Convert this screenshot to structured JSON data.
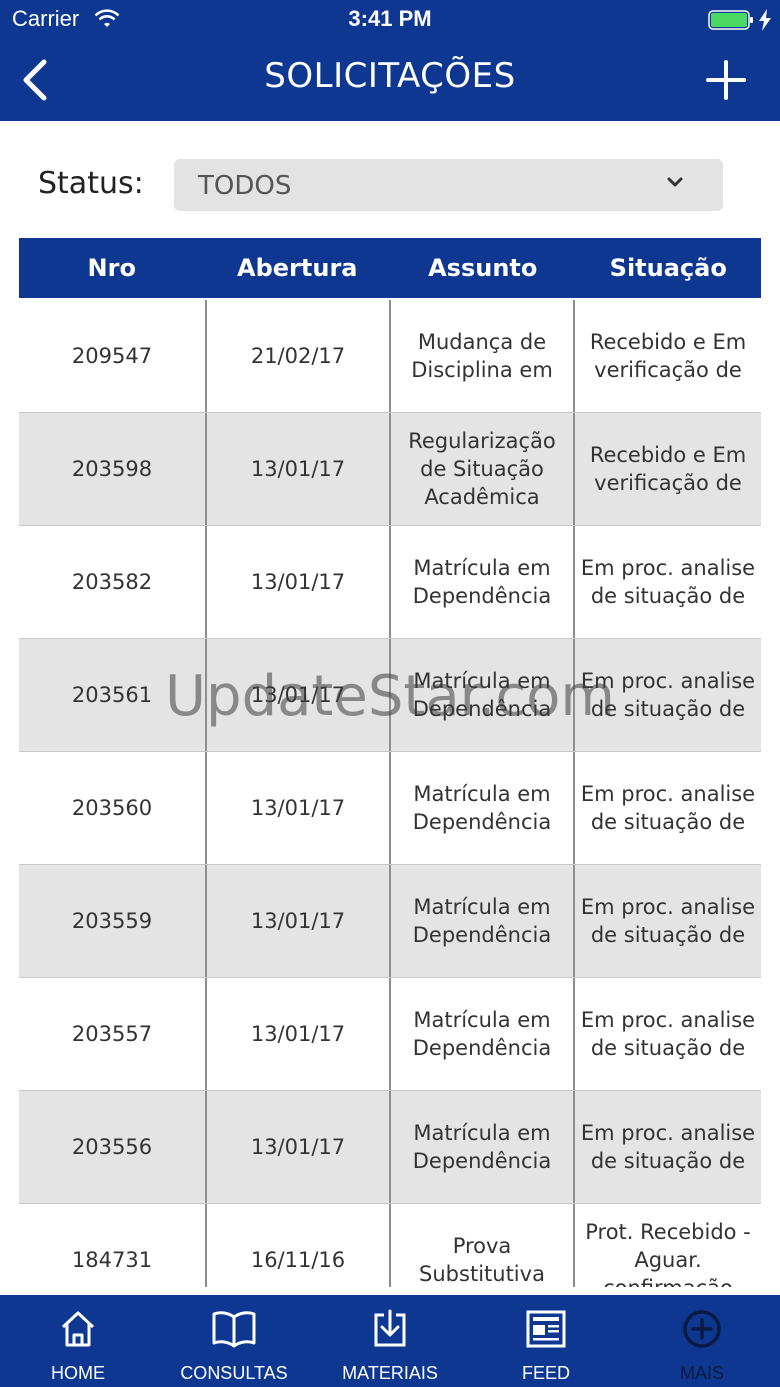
{
  "status_bar": {
    "carrier": "Carrier",
    "time": "3:41 PM"
  },
  "nav": {
    "title": "SOLICITAÇÕES"
  },
  "filter": {
    "label": "Status:",
    "selected": "TODOS"
  },
  "table": {
    "headers": [
      "Nro",
      "Abertura",
      "Assunto",
      "Situação"
    ],
    "rows": [
      {
        "nro": "209547",
        "abertura": "21/02/17",
        "assunto": "Mudança de Disciplina em",
        "situacao": "Recebido e Em verificação de"
      },
      {
        "nro": "203598",
        "abertura": "13/01/17",
        "assunto": "Regularização de Situação Acadêmica",
        "situacao": "Recebido e Em verificação de"
      },
      {
        "nro": "203582",
        "abertura": "13/01/17",
        "assunto": "Matrícula em Dependência",
        "situacao": "Em proc. analise de situação de"
      },
      {
        "nro": "203561",
        "abertura": "13/01/17",
        "assunto": "Matrícula em Dependência",
        "situacao": "Em proc. analise de situação de"
      },
      {
        "nro": "203560",
        "abertura": "13/01/17",
        "assunto": "Matrícula em Dependência",
        "situacao": "Em proc. analise de situação de"
      },
      {
        "nro": "203559",
        "abertura": "13/01/17",
        "assunto": "Matrícula em Dependência",
        "situacao": "Em proc. analise de situação de"
      },
      {
        "nro": "203557",
        "abertura": "13/01/17",
        "assunto": "Matrícula em Dependência",
        "situacao": "Em proc. analise de situação de"
      },
      {
        "nro": "203556",
        "abertura": "13/01/17",
        "assunto": "Matrícula em Dependência",
        "situacao": "Em proc. analise de situação de"
      },
      {
        "nro": "184731",
        "abertura": "16/11/16",
        "assunto": "Prova Substitutiva",
        "situacao": "Prot. Recebido - Aguar. confirmação"
      }
    ]
  },
  "watermark": "UpdateStar.com",
  "tabbar": {
    "items": [
      {
        "label": "HOME",
        "icon": "home-icon"
      },
      {
        "label": "CONSULTAS",
        "icon": "book-icon"
      },
      {
        "label": "MATERIAIS",
        "icon": "download-icon"
      },
      {
        "label": "FEED",
        "icon": "news-icon"
      },
      {
        "label": "MAIS",
        "icon": "plus-circle-icon",
        "active": true
      }
    ]
  },
  "colors": {
    "brand": "#0d3791",
    "row_alt": "#e4e4e4",
    "battery": "#4cd964"
  }
}
